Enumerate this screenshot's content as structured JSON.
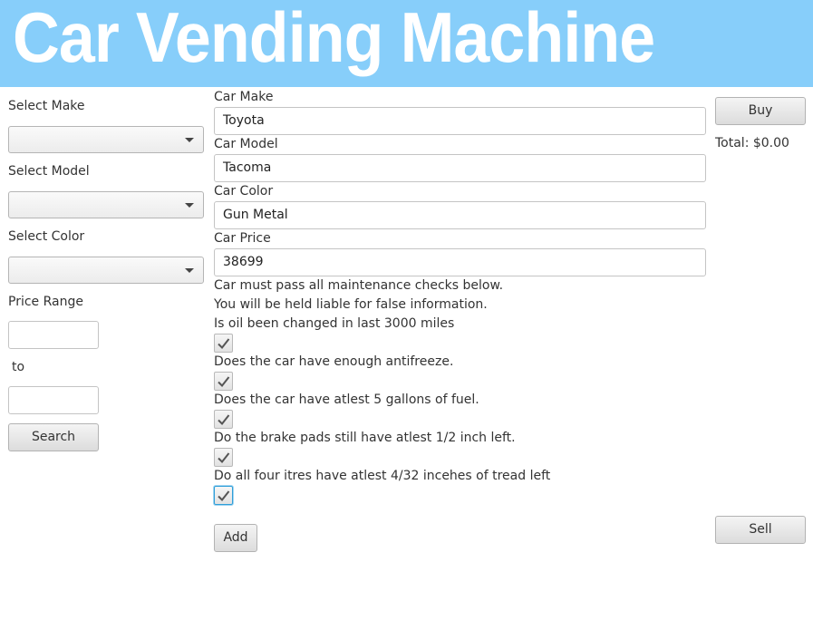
{
  "app": {
    "title": "Car Vending Machine"
  },
  "search_panel": {
    "make_label": "Select Make",
    "make_value": "",
    "model_label": "Select Model",
    "model_value": "",
    "color_label": "Select Color",
    "color_value": "",
    "price_range_label": "Price Range",
    "price_min": "",
    "to_label": "to",
    "price_max": "",
    "search_label": "Search"
  },
  "form": {
    "make_label": "Car Make",
    "make_value": "Toyota",
    "model_label": "Car Model",
    "model_value": "Tacoma",
    "color_label": "Car Color",
    "color_value": "Gun Metal",
    "price_label": "Car Price",
    "price_value": "38699",
    "notice_line1": "Car must pass all maintenance checks below.",
    "notice_line2": "You will be held liable for false information.",
    "checks": [
      {
        "label": "Is oil been changed in last 3000 miles",
        "checked": true
      },
      {
        "label": "Does the car have enough antifreeze.",
        "checked": true
      },
      {
        "label": "Does the car have atlest 5 gallons of fuel.",
        "checked": true
      },
      {
        "label": "Do the brake pads still have atlest 1/2 inch left.",
        "checked": true
      },
      {
        "label": "Do all four itres have atlest 4/32 incehes of tread left",
        "checked": true
      }
    ],
    "add_label": "Add"
  },
  "purchase": {
    "buy_label": "Buy",
    "total_text": "Total: $0.00",
    "sell_label": "Sell"
  },
  "colors": {
    "banner": "#87cefa",
    "focus": "#2f9ed8"
  }
}
